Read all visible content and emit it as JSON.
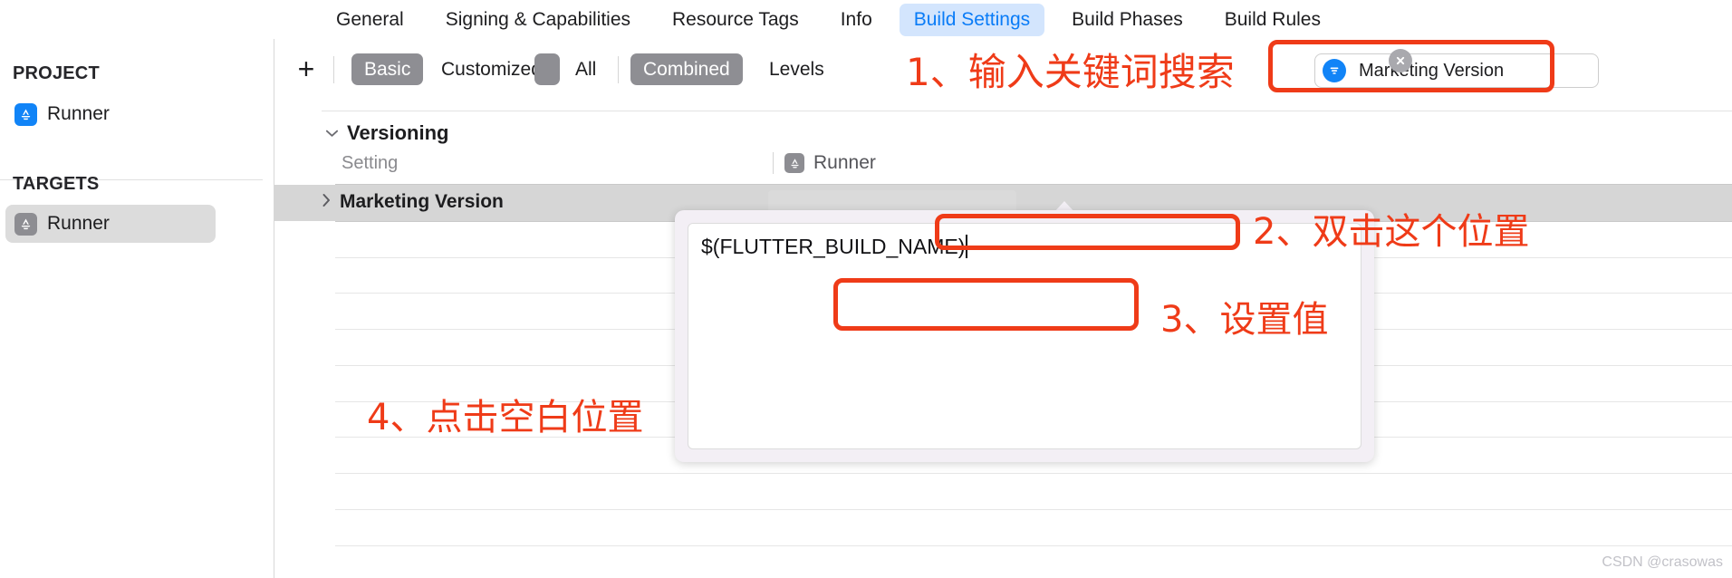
{
  "tabs": [
    {
      "label": "General",
      "selected": false
    },
    {
      "label": "Signing & Capabilities",
      "selected": false
    },
    {
      "label": "Resource Tags",
      "selected": false
    },
    {
      "label": "Info",
      "selected": false
    },
    {
      "label": "Build Settings",
      "selected": true
    },
    {
      "label": "Build Phases",
      "selected": false
    },
    {
      "label": "Build Rules",
      "selected": false
    }
  ],
  "sidebar": {
    "project_header": "PROJECT",
    "project_items": [
      {
        "label": "Runner",
        "icon": "app-store-icon",
        "selected": false
      }
    ],
    "targets_header": "TARGETS",
    "target_items": [
      {
        "label": "Runner",
        "icon": "app-store-icon",
        "selected": true
      }
    ]
  },
  "toolbar": {
    "add_label": "+",
    "scope_segments": [
      {
        "label": "Basic",
        "selected": true
      },
      {
        "label": "Customized",
        "selected": false
      },
      {
        "label": "All",
        "selected": false
      }
    ],
    "level_segments": [
      {
        "label": "Combined",
        "selected": true
      },
      {
        "label": "Levels",
        "selected": false
      }
    ],
    "search": {
      "value": "Marketing Version",
      "placeholder": "Search",
      "filter_icon": "filter-icon",
      "clear_icon": "clear-icon"
    }
  },
  "table": {
    "group": {
      "title": "Versioning",
      "expanded": true,
      "chevron": "chevron-down-icon"
    },
    "columns": {
      "setting": "Setting",
      "target": "Runner"
    },
    "selected_row": {
      "name": "Marketing Version",
      "chevron": "chevron-right-icon",
      "value": ""
    },
    "empty_rows": 9
  },
  "popover": {
    "value": "$(FLUTTER_BUILD_NAME)",
    "caret_visible": true
  },
  "annotations": [
    {
      "id": "step-1",
      "text": "1、输入关键词搜索"
    },
    {
      "id": "step-2",
      "text": "2、双击这个位置"
    },
    {
      "id": "step-3",
      "text": "3、设置值"
    },
    {
      "id": "step-4",
      "text": "4、点击空白位置"
    }
  ],
  "watermark": "CSDN @crasowas",
  "colors": {
    "accent_blue": "#0a7cf7",
    "tab_selected_bg": "#d3e5fd",
    "segment_selected_bg": "#8e8e93",
    "annotation_red": "#ef3b18",
    "row_selected_bg": "#d6d6d6"
  }
}
